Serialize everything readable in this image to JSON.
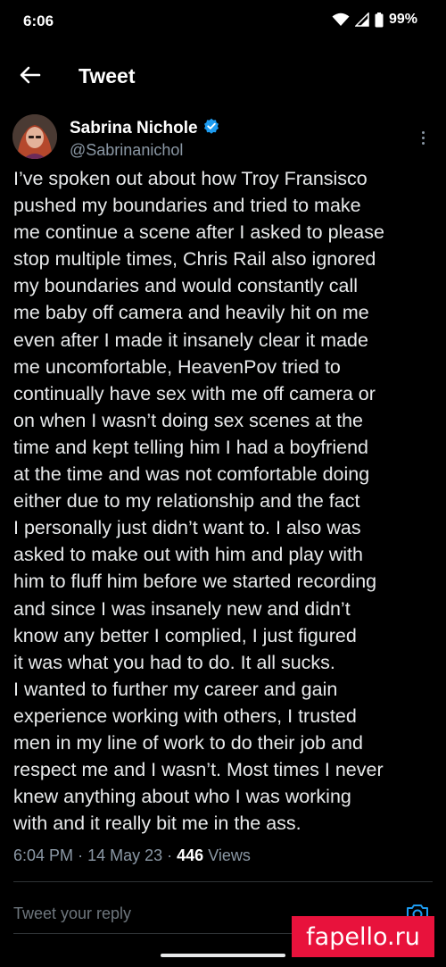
{
  "status_bar": {
    "time": "6:06",
    "battery": "99%"
  },
  "header": {
    "title": "Tweet"
  },
  "tweet": {
    "author_name": "Sabrina Nichole",
    "author_handle": "@Sabrinanichol",
    "verified": true,
    "text": "I’ve spoken out about how Troy Fransisco\npushed my boundaries and tried to make\nme continue a scene after I asked to please\nstop multiple times, Chris Rail also ignored\nmy boundaries and would constantly call\nme baby off camera and heavily hit on me\neven after I made it insanely clear it made\nme uncomfortable, HeavenPov tried to\ncontinually have sex with me off camera or\non when I wasn’t doing sex scenes at the\ntime and kept telling him I had a boyfriend\nat the time and was not comfortable doing\neither due to my relationship and the fact\nI personally just didn’t want to. I also was\nasked to make out with him and play with\nhim to fluff him before we started recording\nand since I was insanely new and didn’t\nknow any better I complied, I just figured\nit was what you had to do. It all sucks.\nI wanted to further my career and gain\nexperience working with others, I trusted\nmen in my line of work to do their job and\nrespect me and I wasn’t. Most times I never\nknew anything about who I was working\nwith and it really bit me in the ass.",
    "time": "6:04 PM",
    "date": "14 May 23",
    "views_count": "446",
    "views_label": "Views"
  },
  "reply": {
    "placeholder": "Tweet your reply"
  },
  "watermark": {
    "text": "fapello.ru"
  },
  "colors": {
    "background": "#000000",
    "text": "#e7e9ea",
    "secondary": "#8b98a5",
    "verified": "#1d9bf0",
    "watermark": "#e8123c"
  }
}
